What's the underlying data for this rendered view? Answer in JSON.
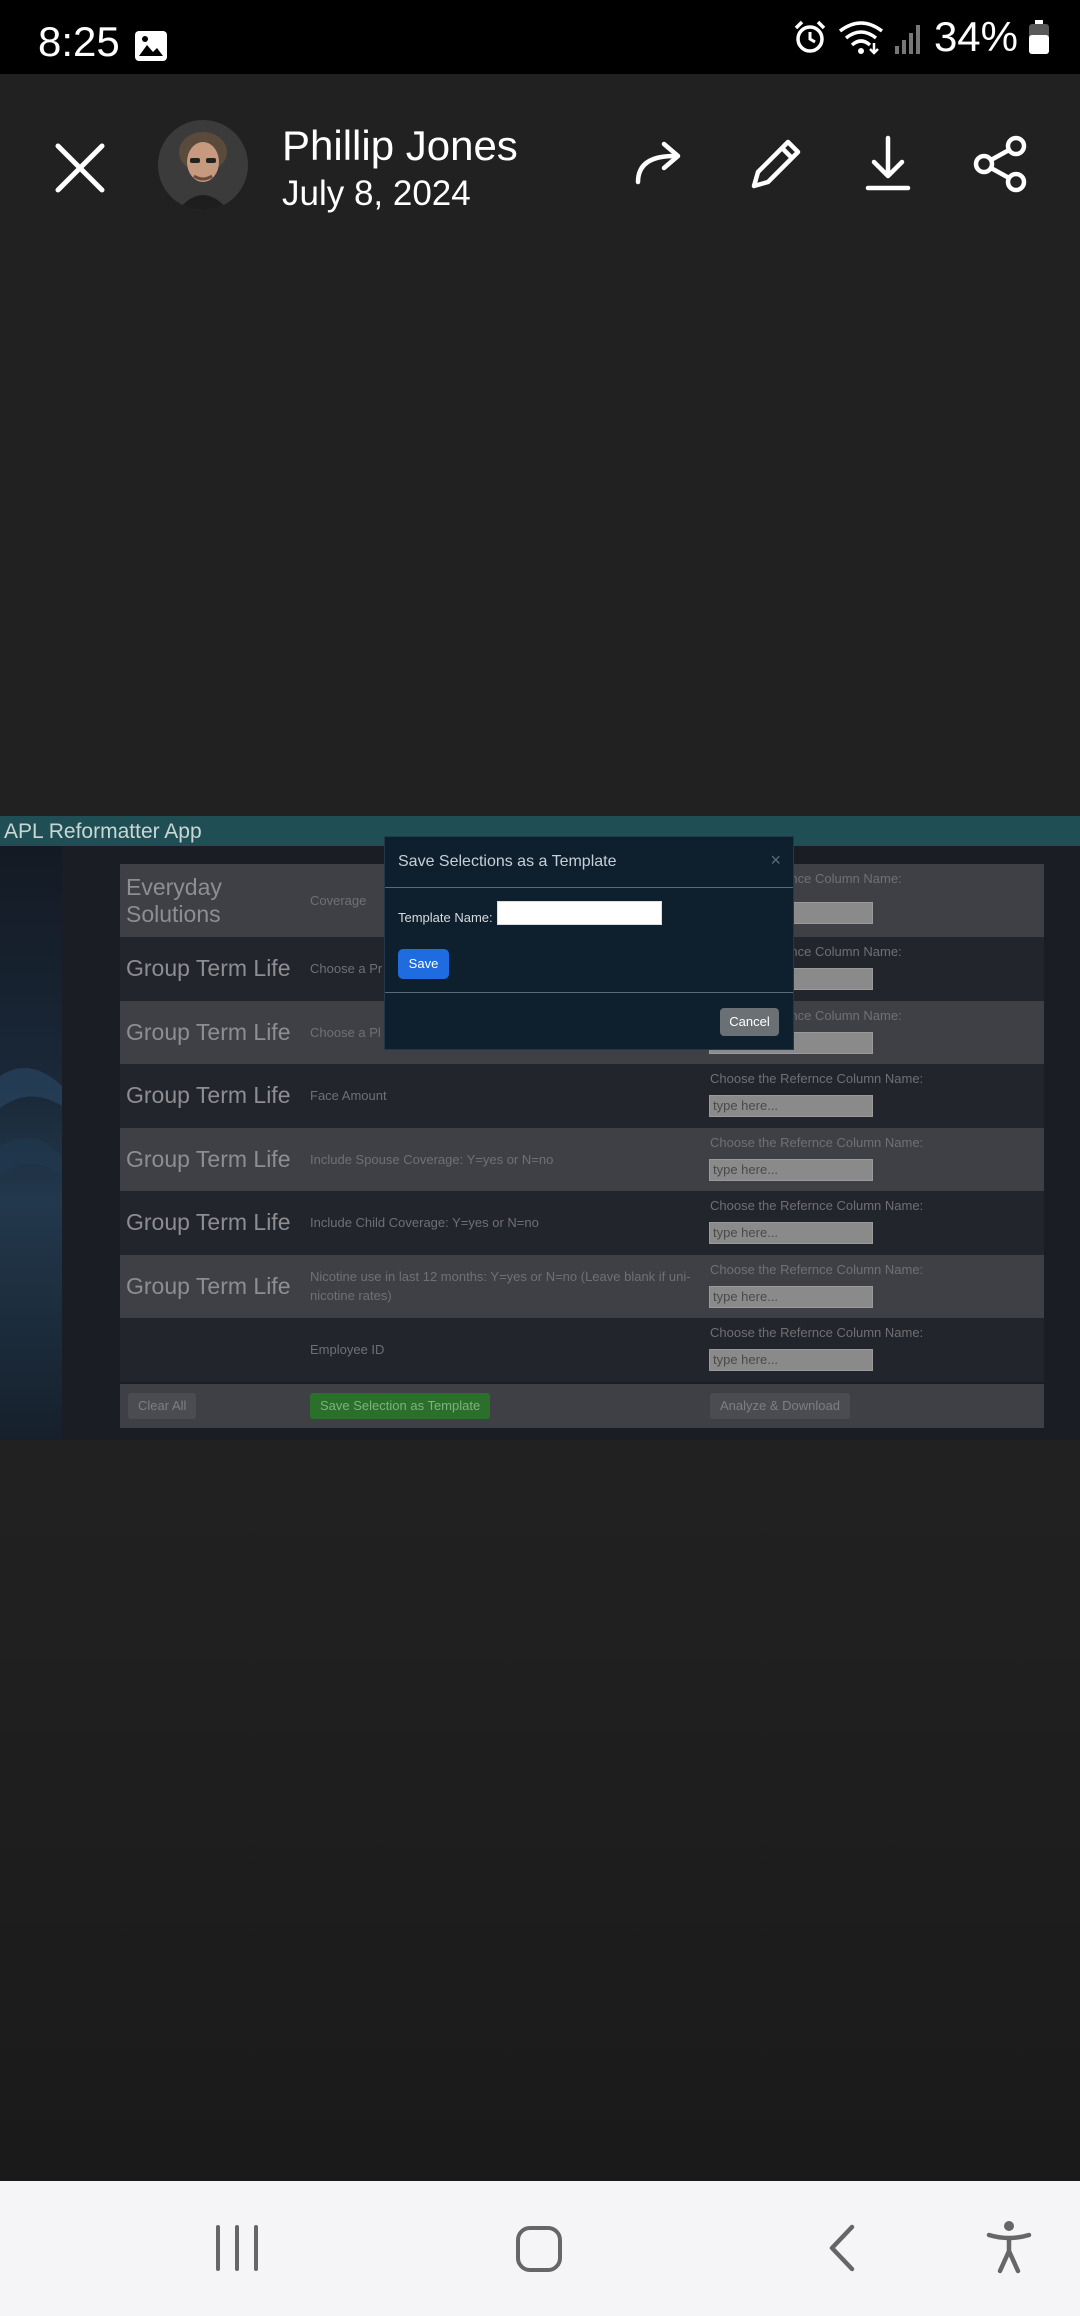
{
  "status_bar": {
    "time": "8:25",
    "battery": "34%"
  },
  "viewer": {
    "sender_name": "Phillip Jones",
    "date": "July 8, 2024"
  },
  "shot": {
    "app_title": "APL Reformatter App",
    "reference_label": "Choose the Refernce Column Name:",
    "input_placeholder": "type here...",
    "rows": [
      {
        "product": "Everyday Solutions",
        "field": "Coverage"
      },
      {
        "product": "Group Term Life",
        "field": "Choose a Pr"
      },
      {
        "product": "Group Term Life",
        "field": "Choose a Pl"
      },
      {
        "product": "Group Term Life",
        "field": "Face Amount"
      },
      {
        "product": "Group Term Life",
        "field": "Include Spouse Coverage: Y=yes or N=no"
      },
      {
        "product": "Group Term Life",
        "field": "Include Child Coverage: Y=yes or N=no"
      },
      {
        "product": "Group Term Life",
        "field": "Nicotine use in last 12 months: Y=yes or N=no (Leave blank if uni-nicotine rates)"
      },
      {
        "product": "",
        "field": "Employee ID"
      }
    ],
    "partial_ref_labels": [
      "efernce Column Name:",
      "efernce Column Name:",
      "efernce Column Name:"
    ],
    "buttons": {
      "clear_all": "Clear All",
      "save_template": "Save Selection as Template",
      "analyze": "Analyze & Download"
    },
    "modal": {
      "title": "Save Selections as a Template",
      "close_symbol": "×",
      "template_name_label": "Template Name:",
      "template_name_value": "",
      "save": "Save",
      "cancel": "Cancel"
    }
  }
}
